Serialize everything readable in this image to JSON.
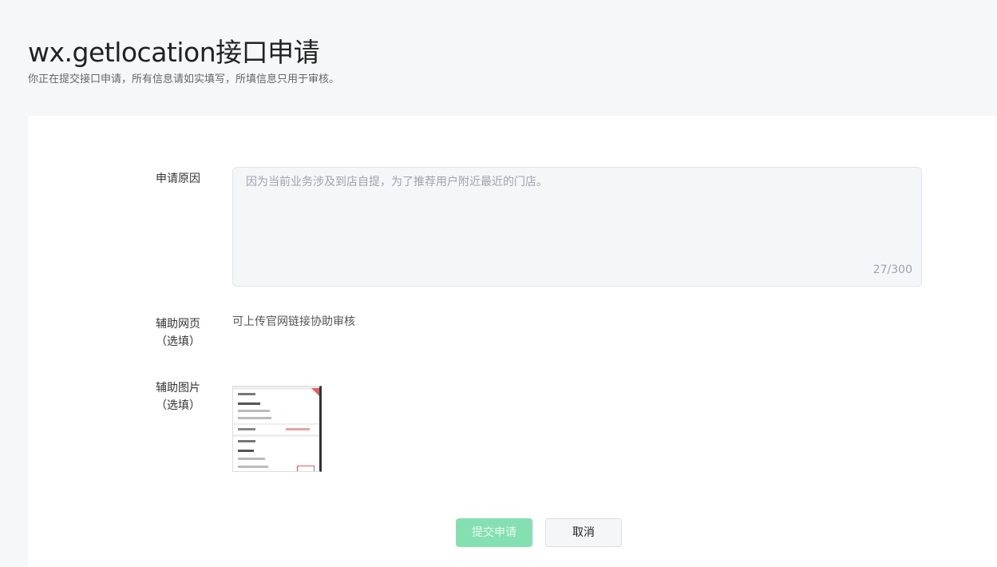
{
  "header": {
    "title": "wx.getlocation接口申请",
    "subtitle": "你正在提交接口申请，所有信息请如实填写，所填信息只用于审核。"
  },
  "form": {
    "reason": {
      "label": "申请原因",
      "placeholder": "因为当前业务涉及到店自提，为了推荐用户附近最近的门店。",
      "counter": "27/300"
    },
    "webpage": {
      "label_line1": "辅助网页",
      "label_line2": "（选填）",
      "hint": "可上传官网链接协助审核"
    },
    "image": {
      "label_line1": "辅助图片",
      "label_line2": "（选填）"
    }
  },
  "actions": {
    "submit_label": "提交申请",
    "cancel_label": "取消"
  },
  "colors": {
    "page_bg": "#f6f7f9",
    "primary_disabled": "#84e0b0",
    "input_bg": "#f5f6f8"
  }
}
